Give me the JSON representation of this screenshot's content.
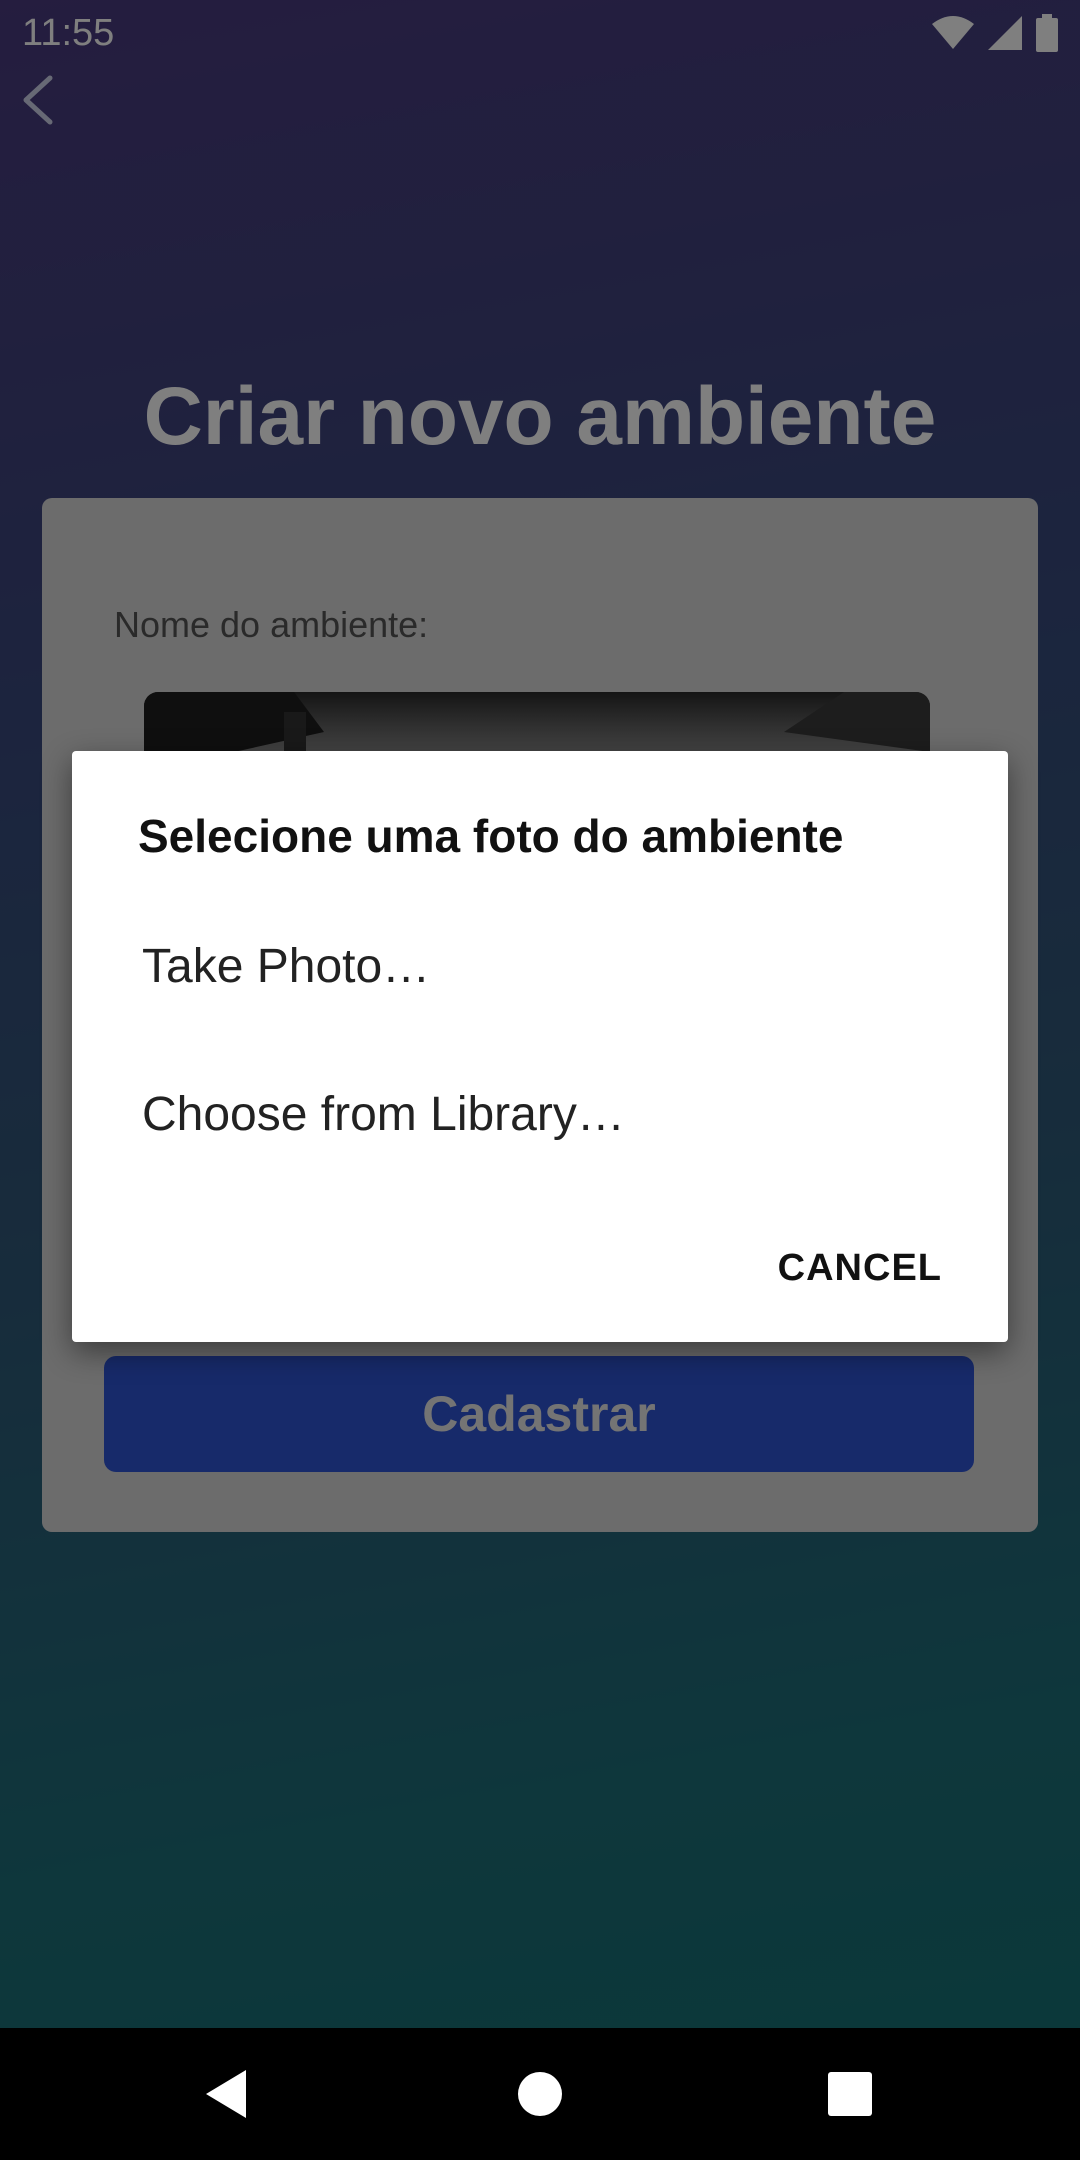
{
  "status": {
    "time": "11:55"
  },
  "page": {
    "title": "Criar novo ambiente"
  },
  "form": {
    "name_label": "Nome do ambiente:",
    "submit_label": "Cadastrar"
  },
  "dialog": {
    "title": "Selecione uma foto do ambiente",
    "options": [
      "Take Photo…",
      "Choose from Library…"
    ],
    "cancel_label": "CANCEL"
  },
  "colors": {
    "submit_button": "#2f55d4",
    "dialog_background": "#ffffff"
  },
  "icons": {
    "back": "chevron-left-icon",
    "wifi": "wifi-icon",
    "signal": "signal-icon",
    "battery": "battery-icon",
    "nav_back": "triangle-back-icon",
    "nav_home": "circle-home-icon",
    "nav_recents": "square-recents-icon"
  }
}
